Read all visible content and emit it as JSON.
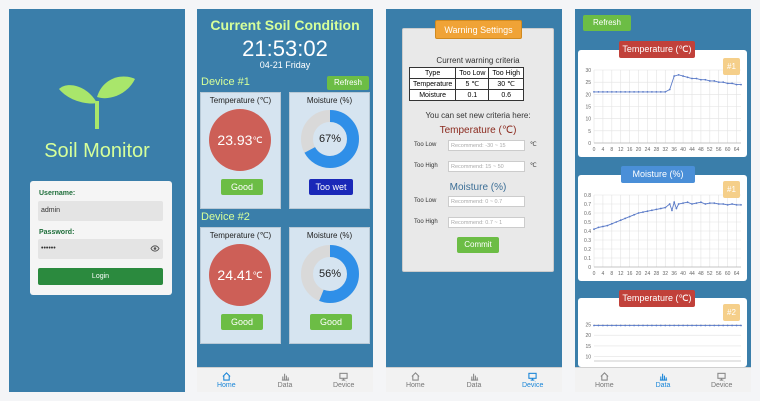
{
  "login": {
    "app_name": "Soil Monitor",
    "username_label": "Username:",
    "username_value": "admin",
    "password_label": "Password:",
    "password_value": "••••••",
    "login_button": "Login"
  },
  "home": {
    "title": "Current Soil Condition",
    "time": "21:53:02",
    "date": "04-21 Friday",
    "refresh": "Refresh",
    "devices": [
      {
        "label": "Device #1",
        "temp_title": "Temperature (℃)",
        "temperature": "23.93",
        "temp_unit": "℃",
        "temp_status": "Good",
        "moist_title": "Moisture (%)",
        "moisture": "67%",
        "moisture_value": 0.67,
        "moist_status": "Too wet"
      },
      {
        "label": "Device #2",
        "temp_title": "Temperature (℃)",
        "temperature": "24.41",
        "temp_unit": "℃",
        "temp_status": "Good",
        "moist_title": "Moisture (%)",
        "moisture": "56%",
        "moisture_value": 0.56,
        "moist_status": "Good"
      }
    ]
  },
  "warning": {
    "title": "Warning Settings",
    "current_criteria": "Current warning criteria",
    "table_headers": [
      "Type",
      "Too Low",
      "Too High"
    ],
    "table_rows": [
      [
        "Temperature",
        "5 ℃",
        "30 ℃"
      ],
      [
        "Moisture",
        "0.1",
        "0.6"
      ]
    ],
    "set_new": "You can set new criteria here:",
    "temp_header": "Temperature (℃)",
    "moist_header": "Moisture (%)",
    "too_low": "Too Low",
    "too_high": "Too High",
    "temp_low_placeholder": "Recommend: -30 ~ 15",
    "temp_high_placeholder": "Recommend: 15 ~ 50",
    "moist_low_placeholder": "Recommend: 0 ~ 0.7",
    "moist_high_placeholder": "Recommend: 0.7 ~ 1",
    "unit": "℃",
    "commit": "Commit"
  },
  "data_page": {
    "refresh": "Refresh"
  },
  "tabbar": {
    "home": "Home",
    "data": "Data",
    "device": "Device"
  },
  "colors": {
    "screen_bg": "#3a7eaa",
    "accent_green": "#6cbd45",
    "temp_red": "#cd5f57",
    "moist_blue": "#2f8fe8",
    "active_tab": "#1a86d8"
  },
  "chart_data": [
    {
      "type": "line",
      "title": "Temperature (℃)",
      "device": "#1",
      "x_ticks": [
        "0",
        "4",
        "8",
        "12",
        "16",
        "20",
        "24",
        "28",
        "32",
        "36",
        "40",
        "44",
        "48",
        "52",
        "56",
        "60",
        "64"
      ],
      "y_ticks": [
        "0",
        "5",
        "10",
        "15",
        "20",
        "25",
        "30"
      ],
      "ylim": [
        0,
        30
      ],
      "xlim": [
        0,
        66
      ],
      "series": [
        {
          "x": [
            0,
            2,
            4,
            6,
            8,
            10,
            12,
            14,
            16,
            18,
            20,
            22,
            24,
            26,
            28,
            30,
            32,
            34,
            36,
            38,
            40,
            42,
            44,
            46,
            48,
            50,
            52,
            54,
            56,
            58,
            60,
            62,
            64,
            66
          ],
          "y": [
            21,
            21,
            21,
            21,
            21,
            21,
            21,
            21,
            21,
            21,
            21,
            21,
            21,
            21,
            21,
            21,
            21,
            22,
            27.5,
            28,
            27.5,
            27,
            26.5,
            26.5,
            26,
            26,
            25.5,
            25.5,
            25,
            25,
            24.5,
            24.5,
            24,
            24
          ]
        }
      ]
    },
    {
      "type": "line",
      "title": "Moisture (%)",
      "device": "#1",
      "x_ticks": [
        "0",
        "4",
        "8",
        "12",
        "16",
        "20",
        "24",
        "28",
        "32",
        "36",
        "40",
        "44",
        "48",
        "52",
        "56",
        "60",
        "64"
      ],
      "y_ticks": [
        "0",
        "0.1",
        "0.2",
        "0.3",
        "0.4",
        "0.5",
        "0.6",
        "0.7",
        "0.8"
      ],
      "ylim": [
        0,
        0.8
      ],
      "xlim": [
        0,
        66
      ],
      "series": [
        {
          "x": [
            0,
            2,
            4,
            6,
            8,
            10,
            12,
            14,
            16,
            18,
            20,
            22,
            24,
            26,
            28,
            30,
            32,
            34,
            35,
            36,
            37,
            38,
            40,
            42,
            44,
            46,
            48,
            50,
            52,
            54,
            56,
            58,
            60,
            62,
            64,
            66
          ],
          "y": [
            0.42,
            0.44,
            0.45,
            0.46,
            0.48,
            0.5,
            0.52,
            0.54,
            0.56,
            0.58,
            0.6,
            0.61,
            0.62,
            0.63,
            0.64,
            0.65,
            0.66,
            0.7,
            0.63,
            0.72,
            0.65,
            0.7,
            0.71,
            0.72,
            0.7,
            0.71,
            0.72,
            0.7,
            0.71,
            0.71,
            0.7,
            0.7,
            0.69,
            0.7,
            0.69,
            0.69
          ]
        }
      ]
    },
    {
      "type": "line",
      "title": "Temperature (℃)",
      "device": "#2",
      "y_ticks": [
        "10",
        "15",
        "20",
        "25"
      ],
      "ylim": [
        8,
        28
      ],
      "xlim": [
        0,
        66
      ],
      "series": [
        {
          "x": [
            0,
            2,
            4,
            6,
            8,
            10,
            12,
            14,
            16,
            18,
            20,
            22,
            24,
            26,
            28,
            30,
            32,
            34,
            36,
            38,
            40,
            42,
            44,
            46,
            48,
            50,
            52,
            54,
            56,
            58,
            60,
            62,
            64,
            66
          ],
          "y": [
            24.5,
            24.5,
            24.5,
            24.5,
            24.5,
            24.5,
            24.5,
            24.5,
            24.5,
            24.5,
            24.5,
            24.5,
            24.5,
            24.5,
            24.5,
            24.5,
            24.5,
            24.5,
            24.5,
            24.5,
            24.5,
            24.5,
            24.5,
            24.5,
            24.5,
            24.5,
            24.5,
            24.5,
            24.5,
            24.5,
            24.5,
            24.5,
            24.5,
            24.5
          ]
        }
      ]
    }
  ]
}
